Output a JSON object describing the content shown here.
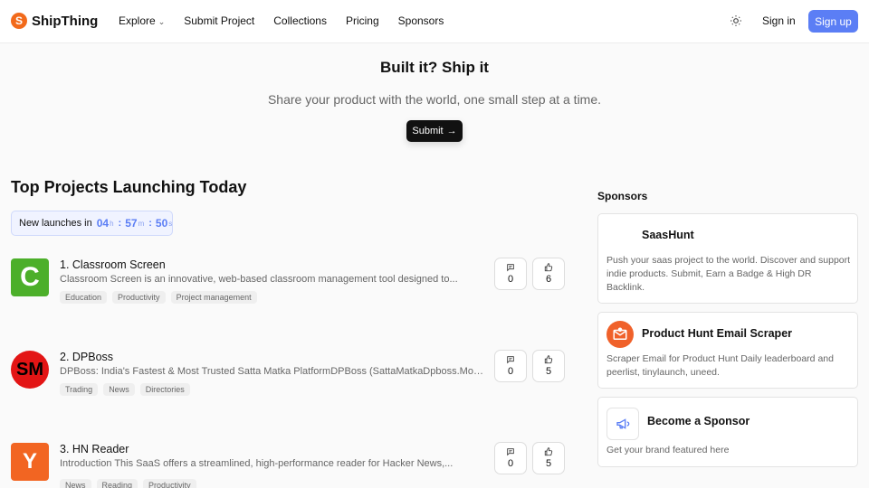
{
  "nav": {
    "logo_letter": "S",
    "logo_text": "ShipThing",
    "links": [
      "Explore",
      "Submit Project",
      "Collections",
      "Pricing",
      "Sponsors"
    ],
    "theme_icon": "sun-icon",
    "signin": "Sign in",
    "signup": "Sign up"
  },
  "hero": {
    "title": "Built it? Ship it",
    "subtitle": "Share your product with the world, one small step at a time.",
    "button": "Submit"
  },
  "section": {
    "title": "Top Projects Launching Today",
    "countdown_label": "New launches in",
    "countdown": [
      {
        "value": "04",
        "unit": "h"
      },
      {
        "value": "57",
        "unit": "m"
      },
      {
        "value": "50",
        "unit": "s"
      }
    ]
  },
  "projects": [
    {
      "title": "1. Classroom Screen",
      "logo_text": "C",
      "logo_color": "#4caf2a",
      "description": "Classroom Screen is an innovative, web-based classroom management tool designed to...",
      "tags": [
        "Education",
        "Productivity",
        "Project management"
      ],
      "comments": "0",
      "upvotes": "6"
    },
    {
      "title": "2. DPBoss",
      "logo_text": "SM",
      "logo_color": "#e31515",
      "description": "DPBoss: India's Fastest & Most Trusted Satta Matka PlatformDPBoss (SattaMatkaDpboss.Mobi)...",
      "tags": [
        "Trading",
        "News",
        "Directories"
      ],
      "comments": "0",
      "upvotes": "5"
    },
    {
      "title": "3. HN Reader",
      "logo_text": "Y",
      "logo_color": "#f26522",
      "description": "Introduction This SaaS offers a streamlined, high-performance reader for Hacker News,...",
      "tags": [
        "News",
        "Reading",
        "Productivity"
      ],
      "comments": "0",
      "upvotes": "5"
    }
  ],
  "sponsors": {
    "title": "Sponsors",
    "cards": [
      {
        "title": "SaasHunt",
        "description": "Push your saas project to the world. Discover and support indie products. Submit, Earn a Badge & High DR Backlink."
      },
      {
        "title": "Product Hunt Email Scraper",
        "icon": "envelope-icon",
        "description": "Scraper Email for Product Hunt Daily leaderboard and peerlist, tinylaunch, uneed."
      },
      {
        "title": "Become a Sponsor",
        "icon": "megaphone-icon",
        "description": "Get your brand featured here"
      }
    ]
  },
  "colors": {
    "accent": "#5b7ef5",
    "brand": "#f26a1b"
  }
}
